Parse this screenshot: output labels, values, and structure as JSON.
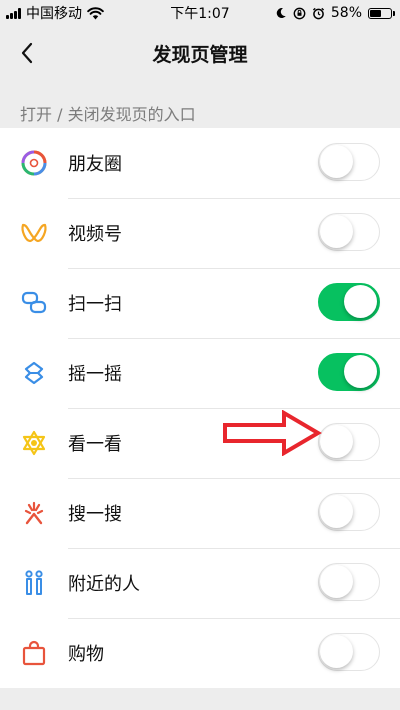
{
  "status_bar": {
    "carrier": "中国移动",
    "time": "下午1:07",
    "battery": "58%",
    "battery_level": 0.58
  },
  "nav": {
    "title": "发现页管理"
  },
  "section": {
    "header": "打开 / 关闭发现页的入口"
  },
  "items": [
    {
      "label": "朋友圈",
      "icon": "moments-icon",
      "enabled": false
    },
    {
      "label": "视频号",
      "icon": "channels-icon",
      "enabled": false
    },
    {
      "label": "扫一扫",
      "icon": "scan-icon",
      "enabled": true
    },
    {
      "label": "摇一摇",
      "icon": "shake-icon",
      "enabled": true
    },
    {
      "label": "看一看",
      "icon": "top-stories-icon",
      "enabled": false
    },
    {
      "label": "搜一搜",
      "icon": "search-icon",
      "enabled": false
    },
    {
      "label": "附近的人",
      "icon": "people-nearby-icon",
      "enabled": false
    },
    {
      "label": "购物",
      "icon": "shopping-icon",
      "enabled": false
    }
  ],
  "colors": {
    "accent_green": "#07c160",
    "background": "#ededed",
    "annotation_red": "#e8262d"
  }
}
